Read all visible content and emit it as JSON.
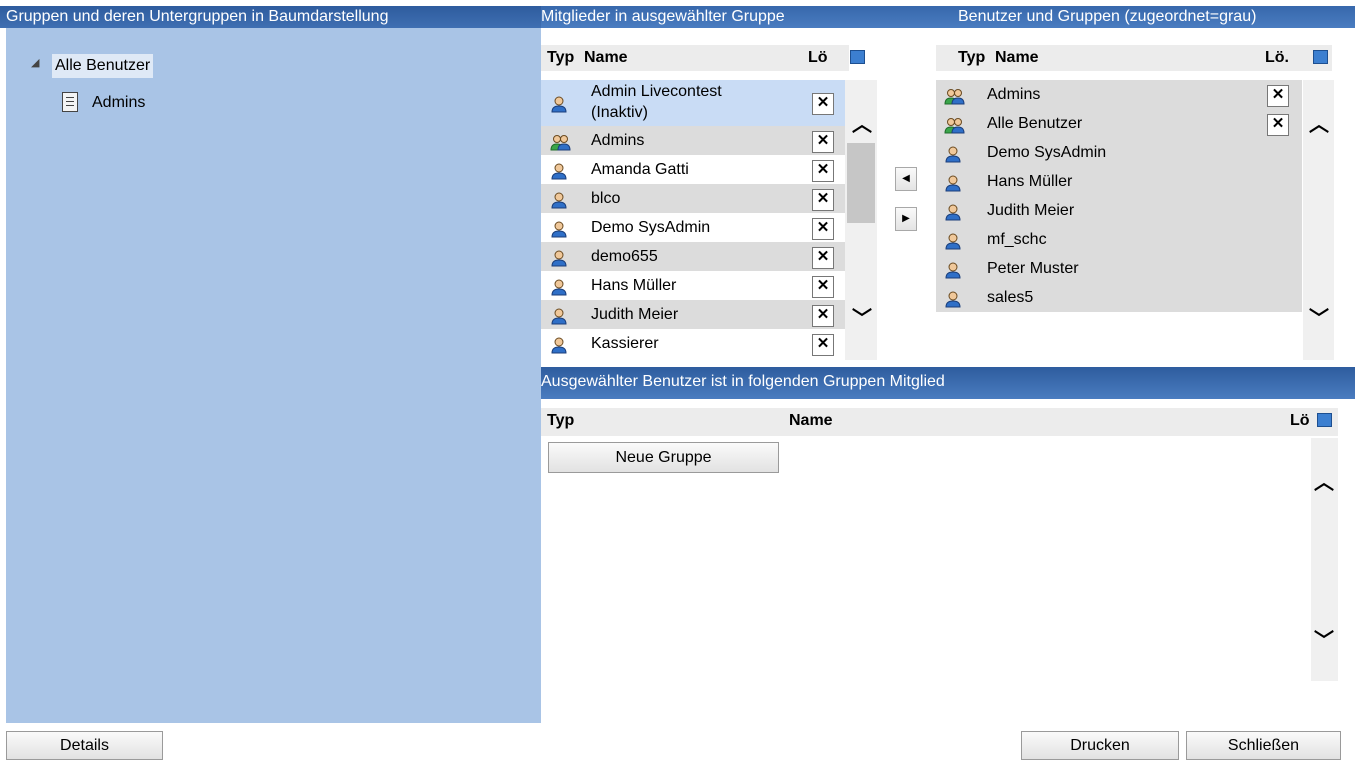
{
  "left_panel": {
    "header": "Gruppen und deren Untergruppen in Baumdarstellung",
    "tree": {
      "root_label": "Alle Benutzer",
      "children": [
        {
          "label": "Admins"
        }
      ]
    }
  },
  "members_panel": {
    "header": "Mitglieder in ausgewählter Gruppe",
    "col_type": "Typ",
    "col_name": "Name",
    "col_del": "Lö",
    "rows": [
      {
        "type": "user",
        "name": "Admin Livecontest",
        "name2": "(Inaktiv)",
        "del": "✕"
      },
      {
        "type": "group",
        "name": "Admins",
        "del": "✕"
      },
      {
        "type": "user",
        "name": "Amanda Gatti",
        "del": "✕"
      },
      {
        "type": "user",
        "name": "blco",
        "del": "✕"
      },
      {
        "type": "user",
        "name": "Demo SysAdmin",
        "del": "✕"
      },
      {
        "type": "user",
        "name": "demo655",
        "del": "✕"
      },
      {
        "type": "user",
        "name": "Hans Müller",
        "del": "✕"
      },
      {
        "type": "user",
        "name": "Judith Meier",
        "del": "✕"
      },
      {
        "type": "user",
        "name": "Kassierer",
        "del": "✕"
      }
    ]
  },
  "transfer": {
    "left_arrow": "◀",
    "right_arrow": "▶"
  },
  "available_panel": {
    "header": "Benutzer und Gruppen (zugeordnet=grau)",
    "col_type": "Typ",
    "col_name": "Name",
    "col_del": "Lö.",
    "rows": [
      {
        "type": "group",
        "name": "Admins",
        "del": "✕"
      },
      {
        "type": "group",
        "name": "Alle Benutzer",
        "del": "✕"
      },
      {
        "type": "user",
        "name": "Demo SysAdmin"
      },
      {
        "type": "user",
        "name": "Hans Müller"
      },
      {
        "type": "user",
        "name": "Judith Meier"
      },
      {
        "type": "user",
        "name": "mf_schc"
      },
      {
        "type": "user",
        "name": "Peter Muster"
      },
      {
        "type": "user",
        "name": "sales5"
      }
    ]
  },
  "membership_panel": {
    "header": "Ausgewählter Benutzer ist in folgenden Gruppen Mitglied",
    "col_type": "Typ",
    "col_name": "Name",
    "col_del": "Lö",
    "new_group_button": "Neue Gruppe"
  },
  "scroll": {
    "up": "^",
    "down": "v"
  },
  "footer": {
    "details_button": "Details",
    "print_button": "Drucken",
    "close_button": "Schließen"
  }
}
